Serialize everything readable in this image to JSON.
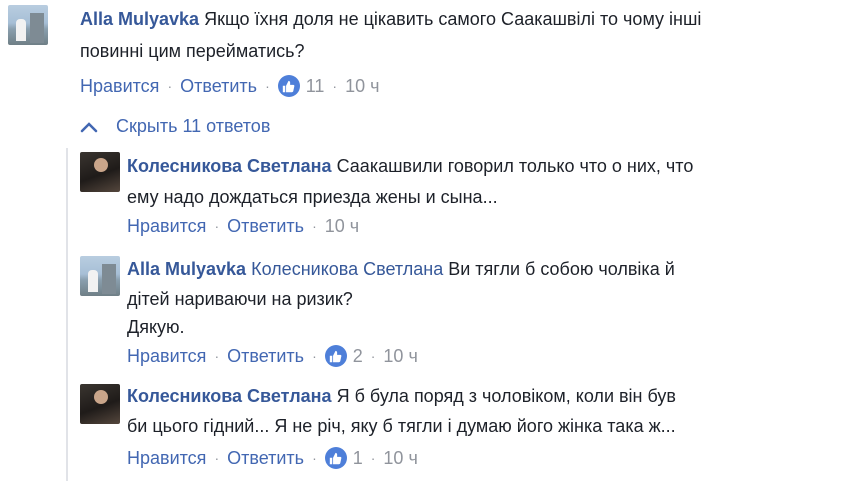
{
  "main_comment": {
    "author": "Alla Mulyavka",
    "text_line1": "Якщо їхня доля не цікавить самого Саакашвілі то чому інші",
    "text_line2": "повинні цим перейматись?",
    "like_label": "Нравится",
    "reply_label": "Ответить",
    "likes": "11",
    "time": "10 ч"
  },
  "replies_toggle": {
    "label": "Скрыть 11 ответов"
  },
  "replies": [
    {
      "author": "Колесникова Светлана",
      "text_line1": "Саакашвили говорил только что о них, что",
      "text_line2": "ему надо дождаться приезда жены и сына...",
      "like_label": "Нравится",
      "reply_label": "Ответить",
      "time": "10 ч"
    },
    {
      "author": "Alla Mulyavka",
      "mention": "Колесникова Светлана",
      "text_line1": "Ви тягли б собою чолвіка й",
      "text_line2": "дітей нариваючи на ризик?",
      "text_line3": "Дякую.",
      "like_label": "Нравится",
      "reply_label": "Ответить",
      "likes": "2",
      "time": "10 ч"
    },
    {
      "author": "Колесникова Светлана",
      "text_line1": "Я б була поряд з чоловіком, коли він був",
      "text_line2": "би цього гідний... Я не річ, яку б тягли і думаю його жінка така ж...",
      "like_label": "Нравится",
      "reply_label": "Ответить",
      "likes": "1",
      "time": "10 ч"
    }
  ],
  "colors": {
    "link": "#365899",
    "action": "#4267b2",
    "meta": "#90949c",
    "like_badge": "#4e7fd9"
  },
  "icons": {
    "like": "thumbs-up-icon",
    "toggle": "chevron-up-icon"
  }
}
